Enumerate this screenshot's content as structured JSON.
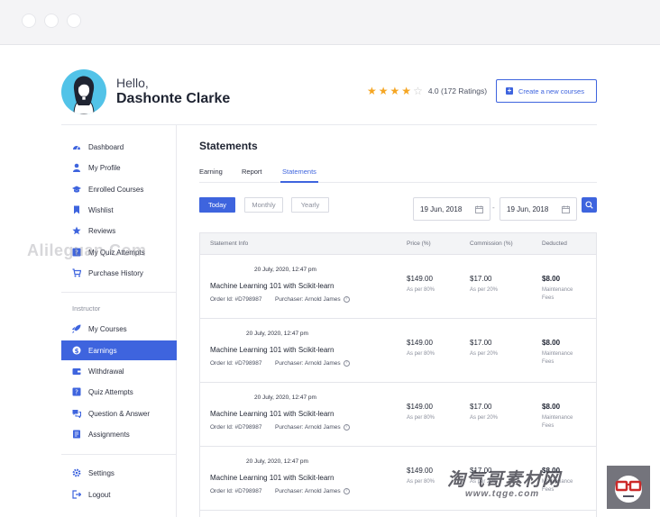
{
  "header": {
    "greeting": "Hello,",
    "user_name": "Dashonte Clarke",
    "rating": {
      "value": 4.0,
      "stars_filled": 4,
      "stars_total": 5,
      "text": "4.0 (172 Ratings)"
    },
    "create_button_label": "Create a new courses"
  },
  "sidebar": {
    "items": [
      {
        "label": "Dashboard",
        "icon": "dashboard-icon"
      },
      {
        "label": "My Profile",
        "icon": "user-icon"
      },
      {
        "label": "Enrolled Courses",
        "icon": "graduation-cap-icon"
      },
      {
        "label": "Wishlist",
        "icon": "bookmark-icon"
      },
      {
        "label": "Reviews",
        "icon": "star-icon"
      },
      {
        "label": "My Quiz Attempts",
        "icon": "quiz-icon"
      },
      {
        "label": "Purchase History",
        "icon": "cart-icon"
      }
    ],
    "instructor_label": "Instructor",
    "instructor_items": [
      {
        "label": "My Courses",
        "icon": "rocket-icon"
      },
      {
        "label": "Earnings",
        "icon": "dollar-icon",
        "active": true
      },
      {
        "label": "Withdrawal",
        "icon": "wallet-icon"
      },
      {
        "label": "Quiz Attempts",
        "icon": "quiz-icon"
      },
      {
        "label": "Question & Answer",
        "icon": "qa-icon"
      },
      {
        "label": "Assignments",
        "icon": "assignment-icon"
      }
    ],
    "footer_items": [
      {
        "label": "Settings",
        "icon": "gear-icon"
      },
      {
        "label": "Logout",
        "icon": "logout-icon"
      }
    ]
  },
  "main": {
    "title": "Statements",
    "tabs": [
      {
        "label": "Earning"
      },
      {
        "label": "Report"
      },
      {
        "label": "Statements",
        "active": true
      }
    ],
    "filters": [
      {
        "label": "Today",
        "active": true
      },
      {
        "label": "Monthly"
      },
      {
        "label": "Yearly"
      }
    ],
    "date_from": "19 Jun, 2018",
    "date_to": "19 Jun, 2018",
    "date_separator": "-"
  },
  "table": {
    "headers": [
      "Statement Info",
      "Price (%)",
      "Commission (%)",
      "Deducted"
    ],
    "rows": [
      {
        "date": "20 July, 2020, 12:47 pm",
        "course": "Machine Learning 101 with Scikit-learn",
        "order": "Order Id: #D798987",
        "purchaser": "Purchaser: Arnold James",
        "price": "$149.00",
        "price_note": "As per 80%",
        "commission": "$17.00",
        "commission_note": "As per 20%",
        "deducted": "$8.00",
        "deducted_note_1": "Maintenance",
        "deducted_note_2": "Fees"
      },
      {
        "date": "20 July, 2020, 12:47 pm",
        "course": "Machine Learning 101 with Scikit-learn",
        "order": "Order Id: #D798987",
        "purchaser": "Purchaser: Arnold James",
        "price": "$149.00",
        "price_note": "As per 80%",
        "commission": "$17.00",
        "commission_note": "As per 20%",
        "deducted": "$8.00",
        "deducted_note_1": "Maintenance",
        "deducted_note_2": "Fees"
      },
      {
        "date": "20 July, 2020, 12:47 pm",
        "course": "Machine Learning 101 with Scikit-learn",
        "order": "Order Id: #D798987",
        "purchaser": "Purchaser: Arnold James",
        "price": "$149.00",
        "price_note": "As per 80%",
        "commission": "$17.00",
        "commission_note": "As per 20%",
        "deducted": "$8.00",
        "deducted_note_1": "Maintenance",
        "deducted_note_2": "Fees"
      },
      {
        "date": "20 July, 2020, 12:47 pm",
        "course": "Machine Learning 101 with Scikit-learn",
        "order": "Order Id: #D798987",
        "purchaser": "Purchaser: Arnold James",
        "price": "$149.00",
        "price_note": "As per 80%",
        "commission": "$17.00",
        "commission_note": "As per 20%",
        "deducted": "$8.00",
        "deducted_note_1": "Maintenance",
        "deducted_note_2": "Fees"
      }
    ]
  },
  "watermarks": {
    "left": "Alileguan.Com",
    "right": "淘气哥素材网",
    "url": "www.tqge.com"
  },
  "colors": {
    "accent": "#3e64de",
    "star": "#f5a623",
    "avatar_bg": "#52c3e8"
  }
}
